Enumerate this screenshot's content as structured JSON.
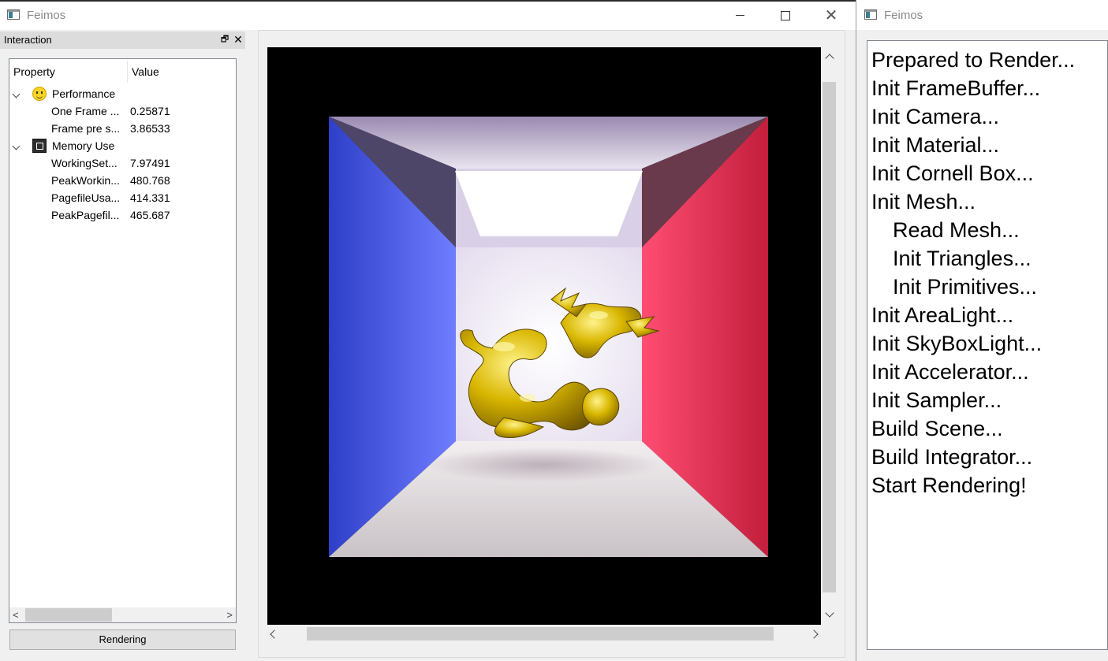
{
  "main_window": {
    "title": "Feimos",
    "window_controls": {
      "minimize": "minimize",
      "maximize": "maximize",
      "close": "✕"
    }
  },
  "dock": {
    "title": "Interaction",
    "float_label": "🗗",
    "close_label": "✕"
  },
  "property_tree": {
    "columns": [
      "Property",
      "Value"
    ],
    "groups": [
      {
        "label": "Performance",
        "icon": "smiley-icon",
        "expanded": true,
        "items": [
          {
            "name": "One Frame ...",
            "value": "0.25871"
          },
          {
            "name": "Frame pre s...",
            "value": "3.86533"
          }
        ]
      },
      {
        "label": "Memory Use",
        "icon": "memory-icon",
        "expanded": true,
        "items": [
          {
            "name": "WorkingSet...",
            "value": "7.97491"
          },
          {
            "name": "PeakWorkin...",
            "value": "480.768"
          },
          {
            "name": "PagefileUsa...",
            "value": "414.331"
          },
          {
            "name": "PeakPagefil...",
            "value": "465.687"
          }
        ]
      }
    ]
  },
  "rendering_button": "Rendering",
  "render_view": {
    "scene": "cornell-box-with-gold-dragon",
    "colors": {
      "left_wall": "#4a5be0",
      "right_wall": "#e0334e",
      "light": "#ffffff",
      "dragon": "#d4b400"
    }
  },
  "log_window": {
    "title": "Feimos",
    "lines": [
      {
        "text": "Prepared to Render...",
        "indent": false
      },
      {
        "text": "Init FrameBuffer...",
        "indent": false
      },
      {
        "text": "Init Camera...",
        "indent": false
      },
      {
        "text": "Init Material...",
        "indent": false
      },
      {
        "text": "Init Cornell Box...",
        "indent": false
      },
      {
        "text": "Init Mesh...",
        "indent": false
      },
      {
        "text": "Read Mesh...",
        "indent": true
      },
      {
        "text": "Init Triangles...",
        "indent": true
      },
      {
        "text": "Init Primitives...",
        "indent": true
      },
      {
        "text": "Init AreaLight...",
        "indent": false
      },
      {
        "text": "Init SkyBoxLight...",
        "indent": false
      },
      {
        "text": "Init Accelerator...",
        "indent": false
      },
      {
        "text": "Init Sampler...",
        "indent": false
      },
      {
        "text": "Build Scene...",
        "indent": false
      },
      {
        "text": "Build Integrator...",
        "indent": false
      },
      {
        "text": "Start Rendering!",
        "indent": false
      }
    ]
  }
}
